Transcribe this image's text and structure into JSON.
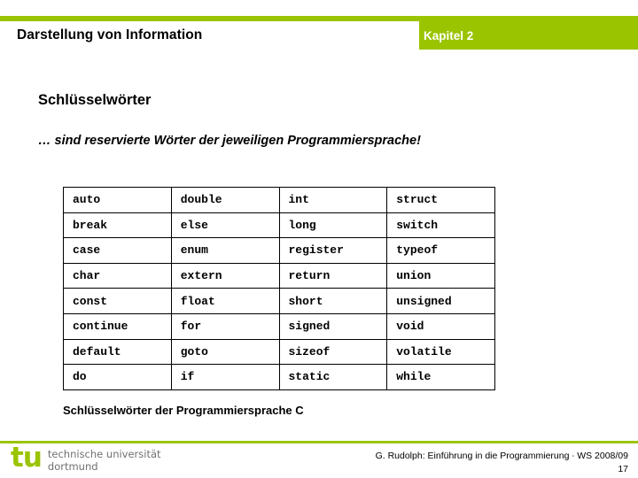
{
  "header": {
    "title": "Darstellung von Information",
    "chapter": "Kapitel 2",
    "accent_color": "#9BC400"
  },
  "main": {
    "section_heading": "Schlüsselwörter",
    "subtitle": "… sind reservierte Wörter der jeweiligen Programmiersprache!",
    "table_caption": "Schlüsselwörter der Programmiersprache C",
    "keywords_table": {
      "rows": [
        [
          "auto",
          "double",
          "int",
          "struct"
        ],
        [
          "break",
          "else",
          "long",
          "switch"
        ],
        [
          "case",
          "enum",
          "register",
          "typeof"
        ],
        [
          "char",
          "extern",
          "return",
          "union"
        ],
        [
          "const",
          "float",
          "short",
          "unsigned"
        ],
        [
          "continue",
          "for",
          "signed",
          "void"
        ],
        [
          "default",
          "goto",
          "sizeof",
          "volatile"
        ],
        [
          "do",
          "if",
          "static",
          "while"
        ]
      ]
    }
  },
  "footer": {
    "logo_mark": "tu",
    "logo_line1": "technische universität",
    "logo_line2": "dortmund",
    "credit": "G. Rudolph: Einführung in die Programmierung ∙ WS 2008/09",
    "page_number": "17",
    "rule_color": "#9BC400"
  }
}
